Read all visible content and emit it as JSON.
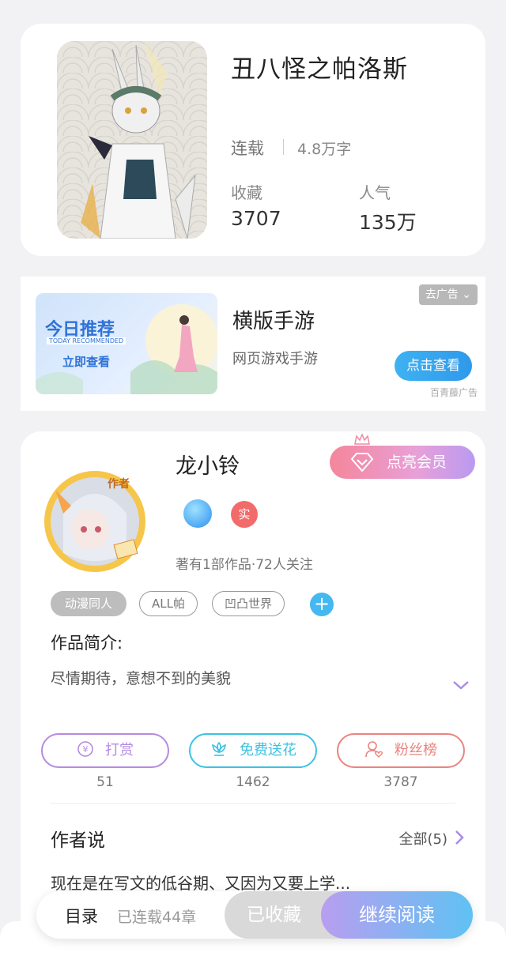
{
  "book": {
    "title": "丑八怪之帕洛斯",
    "status": "连载",
    "word_count": "4.8万字",
    "favorites_label": "收藏",
    "favorites_value": "3707",
    "popularity_label": "人气",
    "popularity_value": "135万"
  },
  "ad": {
    "banner_title": "今日推荐",
    "banner_sub": "TODAY RECOMMENDED",
    "banner_button": "立即查看",
    "title": "横版手游",
    "subtitle": "网页游戏手游",
    "close_label": "去广告",
    "cta": "点击查看",
    "source": "百青藤广告"
  },
  "author": {
    "avatar_badge": "作者",
    "name": "龙小铃",
    "vip_button": "点亮会员",
    "badge_real": "实",
    "meta": "著有1部作品·72人关注",
    "tags": [
      "动漫同人",
      "ALL帕",
      "凹凸世界"
    ],
    "intro_label": "作品简介:",
    "intro_text": "尽情期待，意想不到的美貌",
    "actions": [
      {
        "label": "打赏",
        "count": "51",
        "color": "#b48be0"
      },
      {
        "label": "免费送花",
        "count": "1462",
        "color": "#3cc2e2"
      },
      {
        "label": "粉丝榜",
        "count": "3787",
        "color": "#e8857f"
      }
    ],
    "says_label": "作者说",
    "says_all": "全部(5)",
    "says_text": "现在是在写文的低谷期、又因为又要上学..."
  },
  "bottom": {
    "toc_label": "目录",
    "toc_sub": "已连载44章",
    "favorited": "已收藏",
    "continue": "继续阅读"
  },
  "colors": {
    "accent_purple": "#a98be8",
    "accent_blue": "#44b8f0",
    "background": "#f2f2f4"
  }
}
